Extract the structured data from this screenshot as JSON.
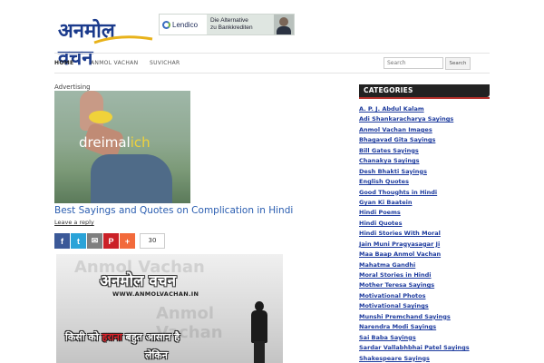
{
  "header": {
    "logo_text": "अनमोल वचन",
    "ad": {
      "brand": "Lendico",
      "copy_line1": "Die Alternative",
      "copy_line2": "zu Bankkrediten"
    }
  },
  "nav": {
    "items": [
      {
        "label": "HOME",
        "active": true
      },
      {
        "label": "ANMOL VACHAN",
        "active": false
      },
      {
        "label": "SUVICHAR",
        "active": false
      }
    ],
    "search": {
      "placeholder": "Search",
      "button_label": "Search"
    }
  },
  "main": {
    "advertising_label": "Advertising",
    "ad_image": {
      "brand_prefix": "dreimal",
      "brand_suffix": "ich"
    },
    "post_title": "Best Sayings and Quotes on Complication in Hindi",
    "leave_reply": "Leave a reply",
    "share": {
      "buttons": [
        {
          "name": "facebook",
          "glyph": "f",
          "color": "#3b5998"
        },
        {
          "name": "twitter",
          "glyph": "t",
          "color": "#2aa3d8"
        },
        {
          "name": "email",
          "glyph": "✉",
          "color": "#7f7f7f"
        },
        {
          "name": "pinterest",
          "glyph": "P",
          "color": "#cb2027"
        },
        {
          "name": "more",
          "glyph": "+",
          "color": "#f26a3b"
        }
      ],
      "count": "30"
    },
    "quote_image": {
      "title": "अनमोल वचन",
      "url": "WWW.ANMOLVACHAN.IN",
      "line1_prefix": "किसी को ",
      "line1_highlight": "हराना",
      "line1_suffix": " बहुत आसान है",
      "line2": "लेकिन",
      "watermark": "Anmol Vachan"
    }
  },
  "sidebar": {
    "header": "CATEGORIES",
    "categories": [
      "A. P. J. Abdul Kalam",
      "Adi Shankaracharya Sayings",
      "Anmol Vachan Images",
      "Bhagavad Gita Sayings",
      "Bill Gates Sayings",
      "Chanakya Sayings",
      "Desh Bhakti Sayings",
      "English Quotes",
      "Good Thoughts in Hindi",
      "Gyan Ki Baatein",
      "Hindi Poems",
      "Hindi Quotes",
      "Hindi Stories With Moral",
      "Jain Muni Pragyasagar Ji",
      "Maa Baap Anmol Vachan",
      "Mahatma Gandhi",
      "Moral Stories in Hindi",
      "Mother Teresa Sayings",
      "Motivational Photos",
      "Motivational Sayings",
      "Munshi Premchand Sayings",
      "Narendra Modi Sayings",
      "Sai Baba Sayings",
      "Sardar Vallabhbhai Patel Sayings",
      "Shakespeare Sayings"
    ]
  },
  "colors": {
    "link": "#1d3b9e",
    "title_link": "#2a5db0",
    "sidebar_header_bg": "#222222",
    "accent_red": "#b3302a"
  }
}
